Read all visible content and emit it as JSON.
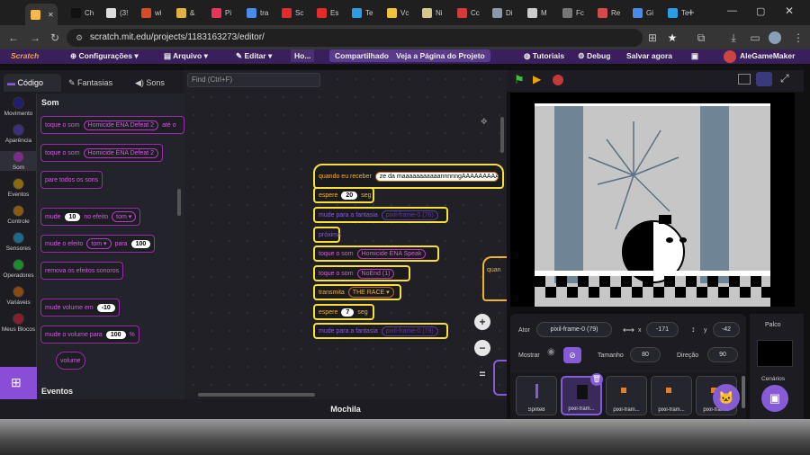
{
  "browser": {
    "tabs": [
      {
        "title": "",
        "color": "#f5b84a"
      },
      {
        "title": "Ch",
        "color": "#111111"
      },
      {
        "title": "(3!",
        "color": "#dddddd"
      },
      {
        "title": "wi",
        "color": "#d94a2b"
      },
      {
        "title": "&",
        "color": "#e0b23d"
      },
      {
        "title": "Pi",
        "color": "#e8335a"
      },
      {
        "title": "tra",
        "color": "#4a8ae8"
      },
      {
        "title": "Sc",
        "color": "#e32b2b"
      },
      {
        "title": "Es",
        "color": "#e32b2b"
      },
      {
        "title": "Te",
        "color": "#2b9ee3"
      },
      {
        "title": "Vc",
        "color": "#f0c23b"
      },
      {
        "title": "Ni",
        "color": "#d8c78a"
      },
      {
        "title": "Cc",
        "color": "#d33b3b"
      },
      {
        "title": "Di",
        "color": "#8899aa"
      },
      {
        "title": "M",
        "color": "#cccccc"
      },
      {
        "title": "Fc",
        "color": "#777777"
      },
      {
        "title": "Re",
        "color": "#d34a4a"
      },
      {
        "title": "Gi",
        "color": "#4a8ae8"
      },
      {
        "title": "Te",
        "color": "#2b9ee3"
      }
    ],
    "url": "scratch.mit.edu/projects/1183163273/editor/"
  },
  "menu": {
    "logo": "Scratch",
    "settings": "Configurações",
    "file": "Arquivo",
    "edit": "Editar",
    "title": "Ho...",
    "share": "Compartilhado",
    "see_project": "Veja a Página do Projeto",
    "tutorials": "Tutoriais",
    "debug": "Debug",
    "save": "Salvar agora",
    "user": "AleGameMaker"
  },
  "editor_tabs": {
    "code": "Código",
    "costumes": "Fantasias",
    "sounds": "Sons"
  },
  "categories": [
    {
      "label": "Movimento",
      "color": "#1e1e6e"
    },
    {
      "label": "Aparência",
      "color": "#3b2f80"
    },
    {
      "label": "Som",
      "color": "#7a2e8a"
    },
    {
      "label": "Eventos",
      "color": "#8a6a10"
    },
    {
      "label": "Controle",
      "color": "#8a5a10"
    },
    {
      "label": "Sensores",
      "color": "#1e6a8a"
    },
    {
      "label": "Operadores",
      "color": "#1e8a2e"
    },
    {
      "label": "Variáveis",
      "color": "#8a4a10"
    },
    {
      "label": "Meus Blocos",
      "color": "#8a1e2e"
    }
  ],
  "palette": {
    "section_title": "Som",
    "events_title": "Eventos",
    "blocks": {
      "play_until": {
        "text": "toque o som",
        "sound": "Homicide ENA Defeat 2",
        "tail": "até o"
      },
      "play": {
        "text": "toque o som",
        "sound": "Homicide ENA Defeat 2"
      },
      "stop_all": {
        "text": "pare todos os sons"
      },
      "change_effect": {
        "text": "mude",
        "value": "10",
        "mid": "no efeito",
        "effect": "tom"
      },
      "set_effect": {
        "text": "mude o efeito",
        "effect": "tom",
        "mid": "para",
        "value": "100"
      },
      "clear_effects": {
        "text": "remova os efeitos sonoros"
      },
      "change_volume": {
        "text": "mude volume em",
        "value": "-10"
      },
      "set_volume": {
        "text": "mude o volume para",
        "value": "100",
        "unit": "%"
      },
      "volume": {
        "text": "volume"
      }
    }
  },
  "workspace": {
    "search_placeholder": "Find (Ctrl+F)",
    "script": {
      "hat": {
        "text": "quando eu receber",
        "message": "ze da maaaaaaaaaaannnnngAAAAAAAAAA"
      },
      "wait1": {
        "text": "espere",
        "value": "20",
        "unit": "seg"
      },
      "switch1": {
        "text": "mude para a fantasia",
        "costume": "pixil-frame-0 (76)"
      },
      "next_costume": {
        "text": "próxima"
      },
      "play_sound": {
        "text": "toque o som",
        "sound": "Homicide ENA Speak"
      },
      "play_sound2": {
        "text": "toque o som",
        "sound": "NoEnd (1)"
      },
      "broadcast": {
        "text": "transmita",
        "message": "THE RACE"
      },
      "wait2": {
        "text": "espere",
        "value": "7",
        "unit": "seg"
      },
      "switch2": {
        "text": "mude para a fantasia",
        "costume": "pixil-frame-0 (79)"
      }
    },
    "partial_hat": "quan",
    "backpack": "Mochila",
    "zoom_in": "+",
    "zoom_out": "−",
    "zoom_reset": "="
  },
  "sprite_info": {
    "sprite_label": "Ator",
    "sprite_name": "pixil-frame-0 (79)",
    "x_label": "x",
    "x_value": "-171",
    "y_label": "y",
    "y_value": "-42",
    "show_label": "Mostrar",
    "size_label": "Tamanho",
    "size_value": "80",
    "direction_label": "Direção",
    "direction_value": "90"
  },
  "sprites": [
    {
      "name": "Sprite8"
    },
    {
      "name": "pixil-fram..."
    },
    {
      "name": "pixil-fram..."
    },
    {
      "name": "pixil-fram..."
    },
    {
      "name": "pixil-fram..."
    }
  ],
  "stage_panel": {
    "title": "Palco",
    "backdrops": "Cenários"
  },
  "colors": {
    "accent": "#855cd6",
    "highlight": "#f7e03b",
    "sound": "#cf63cf"
  }
}
